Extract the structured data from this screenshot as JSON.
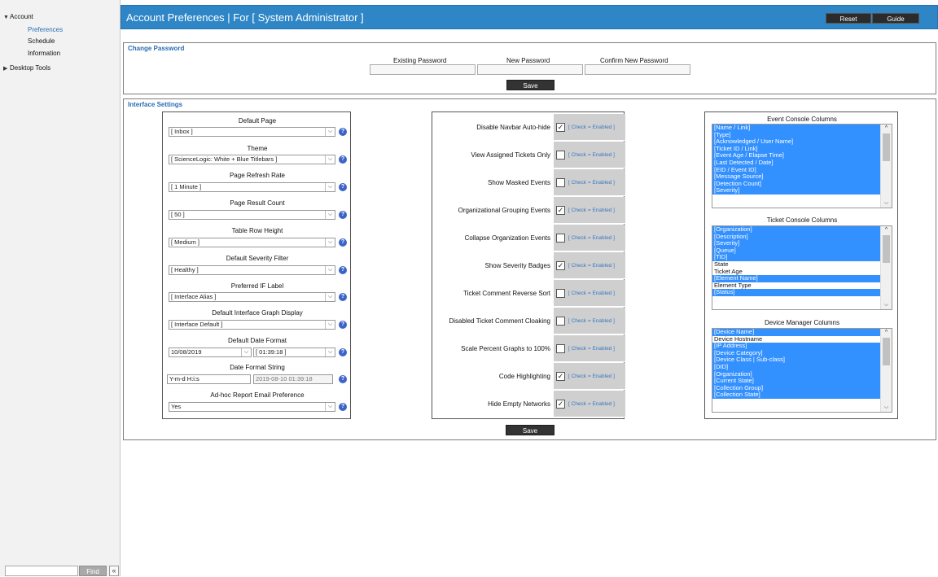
{
  "sidebar": {
    "account": "Account",
    "preferences": "Preferences",
    "schedule": "Schedule",
    "information": "Information",
    "desktop_tools": "Desktop Tools",
    "find_label": "Find",
    "collapse_glyph": "«"
  },
  "header": {
    "title": "Account Preferences | For [ System Administrator ]",
    "reset_label": "Reset",
    "guide_label": "Guide"
  },
  "change_password": {
    "title": "Change Password",
    "existing_label": "Existing Password",
    "new_label": "New Password",
    "confirm_label": "Confirm New Password",
    "save_label": "Save"
  },
  "interface_settings": {
    "title": "Interface Settings",
    "save_label": "Save",
    "fields": {
      "default_page": {
        "label": "Default Page",
        "value": "[ Inbox ]"
      },
      "theme": {
        "label": "Theme",
        "value": "[ ScienceLogic: White + Blue Titlebars ]"
      },
      "refresh_rate": {
        "label": "Page Refresh Rate",
        "value": "[ 1 Minute ]"
      },
      "result_count": {
        "label": "Page Result Count",
        "value": "[ 50 ]"
      },
      "row_height": {
        "label": "Table Row Height",
        "value": "[ Medium ]"
      },
      "severity_filter": {
        "label": "Default Severity Filter",
        "value": "[ Healthy ]"
      },
      "if_label": {
        "label": "Preferred IF Label",
        "value": "[ Interface Alias ]"
      },
      "graph_display": {
        "label": "Default Interface Graph Display",
        "value": "[ Interface Default ]"
      },
      "date_format": {
        "label": "Default Date Format",
        "date_value": "10/08/2019",
        "time_value": "[ 01:39:18 ]"
      },
      "date_format_string": {
        "label": "Date Format String",
        "value": "Y-m-d H:i:s",
        "preview": "2019-08-10 01:39:18"
      },
      "adhoc_email": {
        "label": "Ad-hoc Report Email Preference",
        "value": "Yes"
      }
    },
    "check_hint": "[ Check = Enabled ]",
    "checks": [
      {
        "label": "Disable Navbar Auto-hide",
        "checked": "✓"
      },
      {
        "label": "View Assigned Tickets Only",
        "checked": ""
      },
      {
        "label": "Show Masked Events",
        "checked": ""
      },
      {
        "label": "Organizational Grouping Events",
        "checked": "✓"
      },
      {
        "label": "Collapse Organization Events",
        "checked": ""
      },
      {
        "label": "Show Severity Badges",
        "checked": "✓"
      },
      {
        "label": "Ticket Comment Reverse Sort",
        "checked": ""
      },
      {
        "label": "Disabled Ticket Comment Cloaking",
        "checked": ""
      },
      {
        "label": "Scale Percent Graphs to 100%",
        "checked": ""
      },
      {
        "label": "Code Highlighting",
        "checked": "✓"
      },
      {
        "label": "Hide Empty Networks",
        "checked": "✓"
      }
    ],
    "event_columns": {
      "title": "Event Console Columns",
      "items": [
        "[Name / Link]",
        "[Type]",
        "[Acknowledged / User Name]",
        "[Ticket ID / Link]",
        "[Event Age / Elapse Time]",
        "[Last Detected / Date]",
        "[EID / Event ID]",
        "[Message Source]",
        "[Detection Count]",
        "[Severity]"
      ]
    },
    "ticket_columns": {
      "title": "Ticket Console Columns",
      "items": [
        "[Organization]",
        "[Description]",
        "[Severity]",
        "[Queue]",
        "[TID]",
        "State",
        "Ticket Age",
        "[Element Name]",
        "Element Type",
        "[Status]"
      ]
    },
    "device_columns": {
      "title": "Device Manager Columns",
      "items": [
        "[Device Name]",
        "Device Hostname",
        "[IP Address]",
        "[Device Category]",
        "[Device Class | Sub-class]",
        "[DID]",
        "[Organization]",
        "[Current State]",
        "[Collection Group]",
        "[Collection State]"
      ]
    }
  }
}
